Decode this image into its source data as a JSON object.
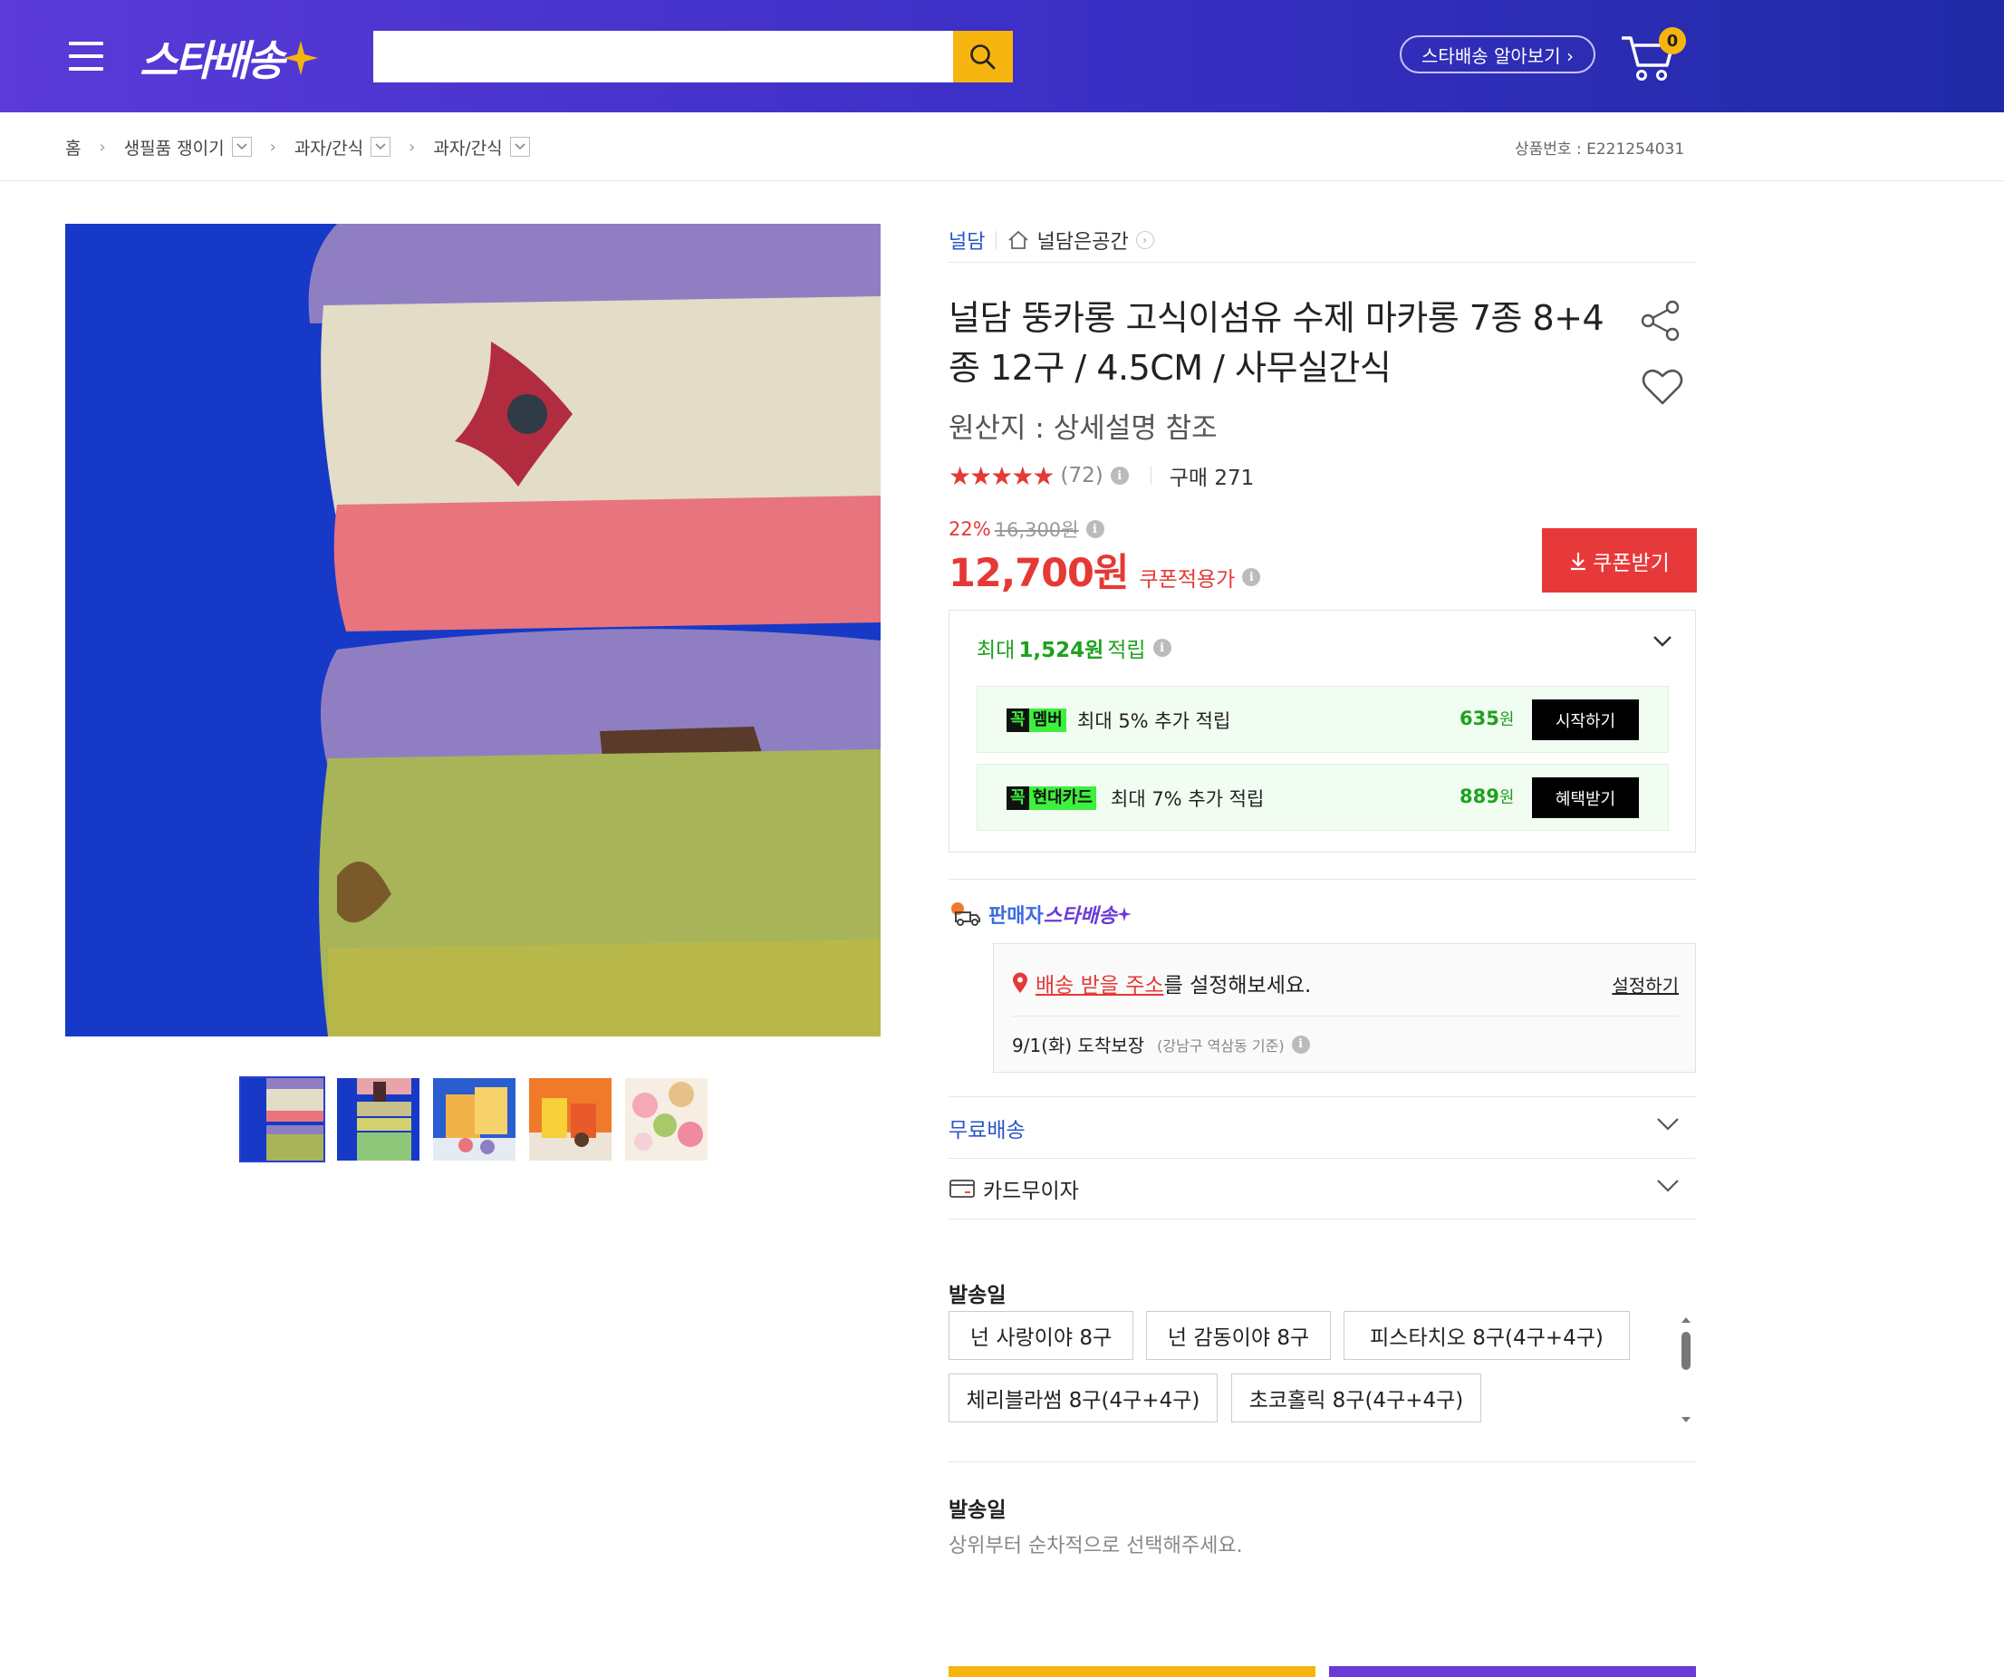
{
  "header": {
    "logo_text": "스타배송",
    "search_placeholder": "",
    "about_label": "스타배송 알아보기 ›",
    "cart_count": "0",
    "colors": {
      "accent": "#f6b40e",
      "header_start": "#5a3ad8",
      "header_end": "#1f2aa6"
    }
  },
  "breadcrumb": {
    "items": [
      "홈",
      "생필품 쟁이기",
      "과자/간식",
      "과자/간식"
    ],
    "product_no_label": "상품번호 : E221254031"
  },
  "gallery": {
    "thumb_count": 5,
    "active_index": 0
  },
  "product": {
    "brand": "널담",
    "store": "널담은공간",
    "title": "널담 뚱카롱 고식이섬유 수제 마카롱 7종 8+4 종 12구 / 4.5CM / 사무실간식",
    "origin": "원산지 : 상세설명 참조",
    "stars": "★★★★★",
    "rating": 4.5,
    "review_count": "(72)",
    "purchase": "구매 271",
    "discount_rate": "22%",
    "original_price": "16,300원",
    "price": "12,700원",
    "coupon_price_label": "쿠폰적용가",
    "coupon_button": "쿠폰받기",
    "colors": {
      "price": "#e53935",
      "points": "#1ea11e",
      "brand": "#2a55c9"
    }
  },
  "points": {
    "prefix": "최대",
    "amount": "1,524원",
    "suffix": "적립",
    "rows": [
      {
        "kk": "꼭",
        "label": "멤버",
        "desc": "최대 5% 추가 적립",
        "amount": "635",
        "unit": "원",
        "action": "시작하기"
      },
      {
        "kk": "꼭",
        "label": "현대카드",
        "desc": "최대 7% 추가 적립",
        "amount": "889",
        "unit": "원",
        "action": "혜택받기"
      }
    ]
  },
  "seller": {
    "label": "판매자",
    "name": "스타배송",
    "address_link": "배송 받을 주소",
    "address_suffix": "를 설정해보세요.",
    "address_action": "설정하기",
    "arrival": "9/1(화) 도착보장",
    "arrival_sub": "(강남구 역삼동 기준)"
  },
  "accordions": {
    "free_shipping": "무료배송",
    "card_installment": "카드무이자"
  },
  "options": {
    "title": "발송일",
    "items": [
      "넌 사랑이야 8구",
      "넌 감동이야 8구",
      "피스타치오 8구(4구+4구)",
      "체리블라썸 8구(4구+4구)",
      "초코홀릭 8구(4구+4구)"
    ],
    "title2": "발송일",
    "hint": "상위부터 순차적으로 선택해주세요."
  }
}
